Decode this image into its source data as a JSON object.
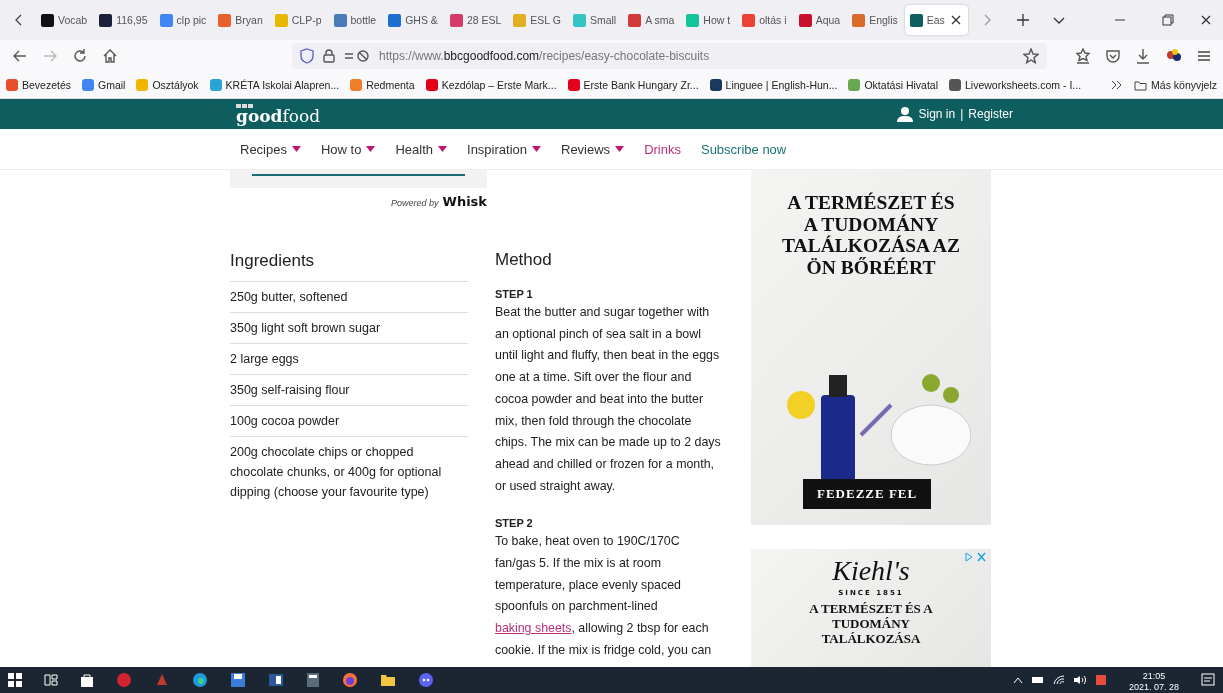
{
  "tabs": [
    {
      "label": "Vocab",
      "color": "#111111",
      "selected": false
    },
    {
      "label": "116,95",
      "color": "#1b1f3a",
      "selected": false
    },
    {
      "label": "clp pic",
      "color": "#4285f4",
      "selected": false
    },
    {
      "label": "Bryan",
      "color": "#e8602c",
      "selected": false
    },
    {
      "label": "CLP-p",
      "color": "#e6b800",
      "selected": false
    },
    {
      "label": "bottle",
      "color": "#4a7ab8",
      "selected": false
    },
    {
      "label": "GHS &",
      "color": "#1c6fd1",
      "selected": false
    },
    {
      "label": "28 ESL",
      "color": "#d63c6b",
      "selected": false
    },
    {
      "label": "ESL G",
      "color": "#e0b020",
      "selected": false
    },
    {
      "label": "Small",
      "color": "#35c4c4",
      "selected": false
    },
    {
      "label": "A sma",
      "color": "#d23a3a",
      "selected": false
    },
    {
      "label": "How t",
      "color": "#15c39a",
      "selected": false
    },
    {
      "label": "oltás i",
      "color": "#ea4335",
      "selected": false
    },
    {
      "label": "Aqua",
      "color": "#c8102e",
      "selected": false
    },
    {
      "label": "Englis",
      "color": "#d96b2b",
      "selected": false
    },
    {
      "label": "Eas",
      "color": "#0e5e5f",
      "selected": true
    }
  ],
  "address": {
    "prefix": "https://www.",
    "domain": "bbcgoodfood.com",
    "path": "/recipes/easy-chocolate-biscuits"
  },
  "bookmarks": [
    {
      "label": "Bevezetés",
      "color": "#e8502c"
    },
    {
      "label": "Gmail",
      "color": "#4285f4"
    },
    {
      "label": "Osztályok",
      "color": "#f2b600"
    },
    {
      "label": "KRÉTA Iskolai Alapren...",
      "color": "#2aa3d6"
    },
    {
      "label": "Redmenta",
      "color": "#f07d2a"
    },
    {
      "label": "Kezdólap – Erste Mark...",
      "color": "#e3001b"
    },
    {
      "label": "Erste Bank Hungary Zr...",
      "color": "#e3001b"
    },
    {
      "label": "Linguee | English-Hun...",
      "color": "#1a3a5c"
    },
    {
      "label": "Oktatási Hivatal",
      "color": "#6aa84f"
    },
    {
      "label": "Liveworksheets.com - I...",
      "color": "#555555"
    }
  ],
  "other_bookmarks": "Más könyvjelz",
  "site": {
    "logo": "**good**food",
    "sign_in": "Sign in",
    "separator": "|",
    "register": "Register",
    "nav": [
      {
        "label": "Recipes",
        "kind": "dropdown"
      },
      {
        "label": "How to",
        "kind": "dropdown"
      },
      {
        "label": "Health",
        "kind": "dropdown"
      },
      {
        "label": "Inspiration",
        "kind": "dropdown"
      },
      {
        "label": "Reviews",
        "kind": "dropdown"
      },
      {
        "label": "Drinks",
        "kind": "highlight"
      },
      {
        "label": "Subscribe now",
        "kind": "subscribe"
      }
    ]
  },
  "recipe": {
    "powered_by": "Powered by",
    "whisk": "Whisk",
    "ingredients_title": "Ingredients",
    "ingredients": [
      "250g butter, softened",
      "350g light soft brown sugar",
      "2 large eggs",
      "350g self-raising flour",
      "100g cocoa powder",
      "200g chocolate chips or chopped chocolate chunks, or 400g for optional dipping (choose your favourite type)"
    ],
    "method_title": "Method",
    "steps": [
      {
        "title": "STEP 1",
        "text": "Beat the butter and sugar together with an optional pinch of sea salt in a bowl until light and fluffy, then beat in the eggs one at a time. Sift over the flour and cocoa powder and beat into the butter mix, then fold through the chocolate chips. The mix can be made up to 2 days ahead and chilled or frozen for a month, or used straight away."
      },
      {
        "title": "STEP 2",
        "text": "To bake, heat oven to 190C/170C fan/gas 5. If the mix is at room temperature, place evenly spaced spoonfuls on parchment-lined",
        "link": "baking sheets",
        "text_after": ", allowing 2 tbsp for each cookie. If the mix is fridge cold, you can"
      }
    ]
  },
  "ads": [
    {
      "headline": "A TERMÉSZET ÉS A TUDOMÁNY TALÁLKOZÁSA AZ ÖN BŐRÉÉRT",
      "button": "FEDEZZE FEL"
    },
    {
      "brand": "Kiehl's",
      "tagline": "SINCE 1851",
      "headline": "A TERMÉSZET ÉS A TUDOMÁNY TALÁLKOZÁSA"
    }
  ],
  "taskbar": {
    "time": "21:05",
    "date": "2021. 07. 28"
  }
}
